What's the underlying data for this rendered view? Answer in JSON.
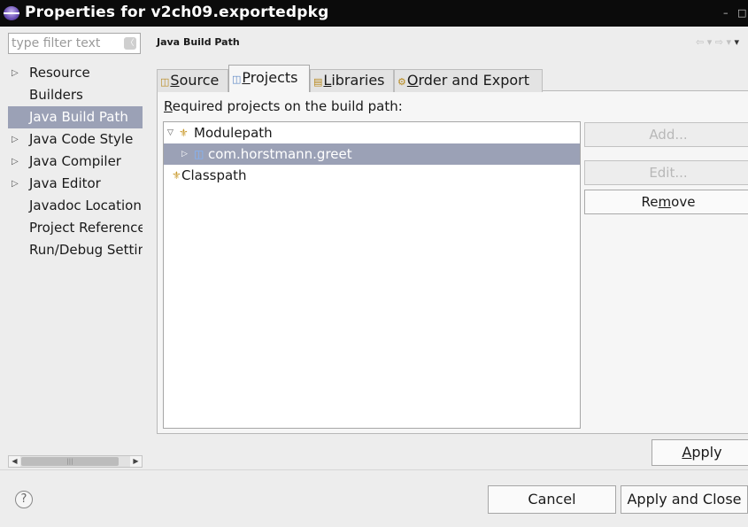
{
  "window": {
    "title": "Properties for v2ch09.exportedpkg"
  },
  "filter": {
    "placeholder": "type filter text"
  },
  "nav": {
    "items": [
      {
        "label": "Resource",
        "expandable": true
      },
      {
        "label": "Builders",
        "expandable": false
      },
      {
        "label": "Java Build Path",
        "expandable": false,
        "selected": true
      },
      {
        "label": "Java Code Style",
        "expandable": true
      },
      {
        "label": "Java Compiler",
        "expandable": true
      },
      {
        "label": "Java Editor",
        "expandable": true
      },
      {
        "label": "Javadoc Location",
        "expandable": false
      },
      {
        "label": "Project References",
        "expandable": false
      },
      {
        "label": "Run/Debug Settings",
        "expandable": false
      }
    ]
  },
  "page": {
    "title": "Java Build Path",
    "tabs": [
      {
        "label": "Source",
        "mnemonic": "S",
        "rest": "ource",
        "icon": "source-folder-icon"
      },
      {
        "label": "Projects",
        "mnemonic": "P",
        "rest": "rojects",
        "icon": "project-icon",
        "active": true
      },
      {
        "label": "Libraries",
        "mnemonic": "L",
        "rest": "ibraries",
        "icon": "library-icon"
      },
      {
        "label": "Order and Export",
        "mnemonic": "O",
        "rest": "rder and Export",
        "icon": "order-icon"
      }
    ],
    "required_label_mnemonic": "R",
    "required_label_rest": "equired projects on the build path:",
    "tree": [
      {
        "label": "Modulepath",
        "level": 0,
        "expanded": true,
        "icon": "modulepath-icon"
      },
      {
        "label": "com.horstmann.greet",
        "level": 1,
        "expanded": false,
        "selected": true,
        "icon": "project-folder-icon"
      },
      {
        "label": "Classpath",
        "level": 0,
        "icon": "classpath-icon"
      }
    ],
    "buttons": {
      "add": "Add...",
      "edit": "Edit...",
      "remove_pre": "Re",
      "remove_mnemonic": "m",
      "remove_post": "ove"
    }
  },
  "footer": {
    "apply_mnemonic": "A",
    "apply_rest": "pply",
    "cancel": "Cancel",
    "apply_and_close": "Apply and Close"
  },
  "colors": {
    "selection": "#9ba1b6",
    "titlebar": "#0b0b0b",
    "disabled_text": "#b8b8b8"
  }
}
